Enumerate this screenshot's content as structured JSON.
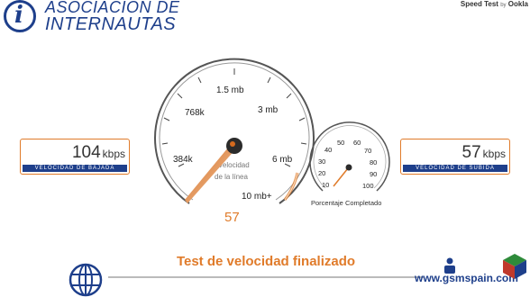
{
  "header": {
    "logo_line1": "ASOCIACIÓN DE",
    "logo_line2": "INTERNAUTAS",
    "logo_icon": "i",
    "brand_name": "Speed Test",
    "brand_by": "by",
    "brand_owner": "Ookla"
  },
  "download": {
    "value": "104",
    "unit": "kbps",
    "label": "VELOCIDAD DE BAJADA"
  },
  "upload": {
    "value": "57",
    "unit": "kbps",
    "label": "VELOCIDAD DE SUBIDA"
  },
  "speed_gauge": {
    "ticks": [
      "384k",
      "768k",
      "1.5 mb",
      "3 mb",
      "6 mb",
      "10 mb+"
    ],
    "center_label_1": "Velocidad",
    "center_label_2": "de la línea",
    "reading": "57"
  },
  "progress_gauge": {
    "ticks": [
      "10",
      "20",
      "30",
      "40",
      "50",
      "60",
      "70",
      "80",
      "90",
      "100"
    ],
    "label": "Porcentaje Completado"
  },
  "status": "Test de velocidad finalizado",
  "watermark": "www.gsmspain.com",
  "colors": {
    "brand_blue": "#1e3f8b",
    "accent_orange": "#e07b2a"
  },
  "icons": [
    "globe-icon",
    "person-icon",
    "cube-icon"
  ]
}
